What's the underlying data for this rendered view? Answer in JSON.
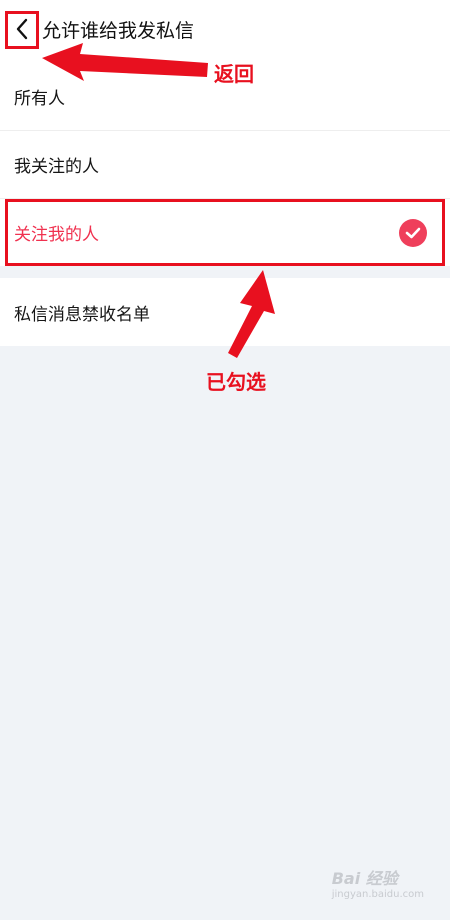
{
  "header": {
    "title": "允许谁给我发私信",
    "back_icon": "chevron-left-icon"
  },
  "options": [
    {
      "label": "所有人",
      "selected": false
    },
    {
      "label": "我关注的人",
      "selected": false
    },
    {
      "label": "关注我的人",
      "selected": true
    }
  ],
  "blocklist": {
    "label": "私信消息禁收名单"
  },
  "annotations": {
    "back_label": "返回",
    "selected_label": "已勾选",
    "color": "#e8101f"
  },
  "watermark": {
    "text": "Bai 经验",
    "subtext": "jingyan.baidu.com"
  },
  "colors": {
    "accent": "#f0314f",
    "background": "#f0f3f7"
  }
}
